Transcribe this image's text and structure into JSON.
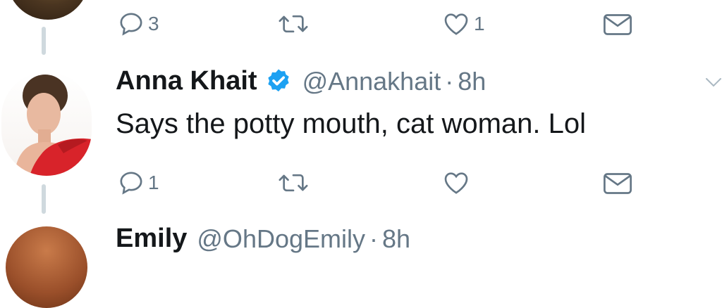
{
  "tweet_top": {
    "reply_count": "3",
    "retweet_count": "",
    "like_count": "1"
  },
  "tweet_main": {
    "display_name": "Anna Khait",
    "handle": "@Annakhait",
    "separator": "·",
    "time": "8h",
    "text": "Says the potty mouth, cat woman. Lol",
    "reply_count": "1",
    "retweet_count": "",
    "like_count": ""
  },
  "tweet_next": {
    "display_name": "Emily",
    "handle": "@OhDogEmily",
    "separator": "·",
    "time": "8h"
  },
  "colors": {
    "text": "#14171a",
    "secondary": "#657786",
    "verified": "#1da1f2",
    "thread_line": "#cfd9de"
  }
}
